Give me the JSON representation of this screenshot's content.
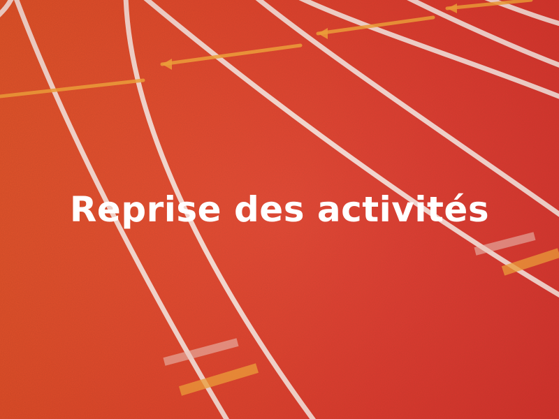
{
  "image": {
    "subject": "running-track-background",
    "title": "Reprise des activités",
    "colors": {
      "track": "#e4412e",
      "lane_line": "#f7e7e0",
      "marker_yellow": "#f2a63a",
      "text": "#ffffff"
    }
  }
}
